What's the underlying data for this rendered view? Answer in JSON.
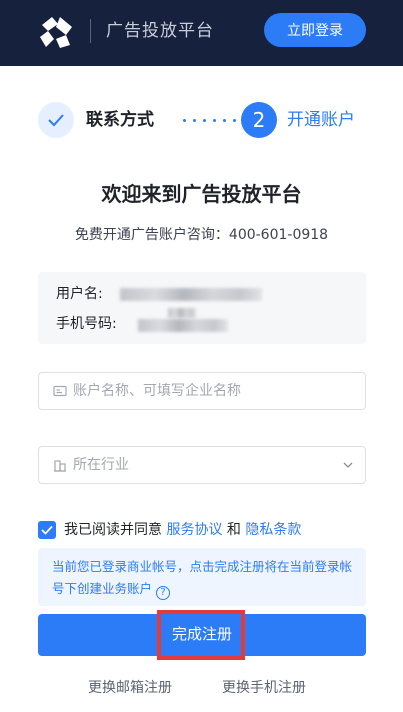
{
  "header": {
    "platform_name": "广告投放平台",
    "login_label": "立即登录"
  },
  "steps": {
    "step1_label": "联系方式",
    "step2_number": "2",
    "step2_label": "开通账户"
  },
  "main": {
    "title": "欢迎来到广告投放平台",
    "consult_text": "免费开通广告账户咨询：400-601-0918"
  },
  "info": {
    "username_label": "用户名:",
    "phone_label": "手机号码:"
  },
  "form": {
    "account_placeholder": "账户名称、可填写企业名称",
    "industry_placeholder": "所在行业"
  },
  "agreement": {
    "prefix": "我已阅读并同意",
    "service_link": "服务协议",
    "and": "和",
    "privacy_link": "隐私条款",
    "checked": true
  },
  "notice": {
    "text": "当前您已登录商业帐号，点击完成注册将在当前登录帐号下创建业务账户",
    "help_glyph": "?"
  },
  "submit_label": "完成注册",
  "footer": {
    "email_register": "更换邮箱注册",
    "phone_register": "更换手机注册"
  },
  "colors": {
    "header_bg": "#16213d",
    "primary": "#2b7cf6",
    "highlight": "#e33b3b"
  }
}
